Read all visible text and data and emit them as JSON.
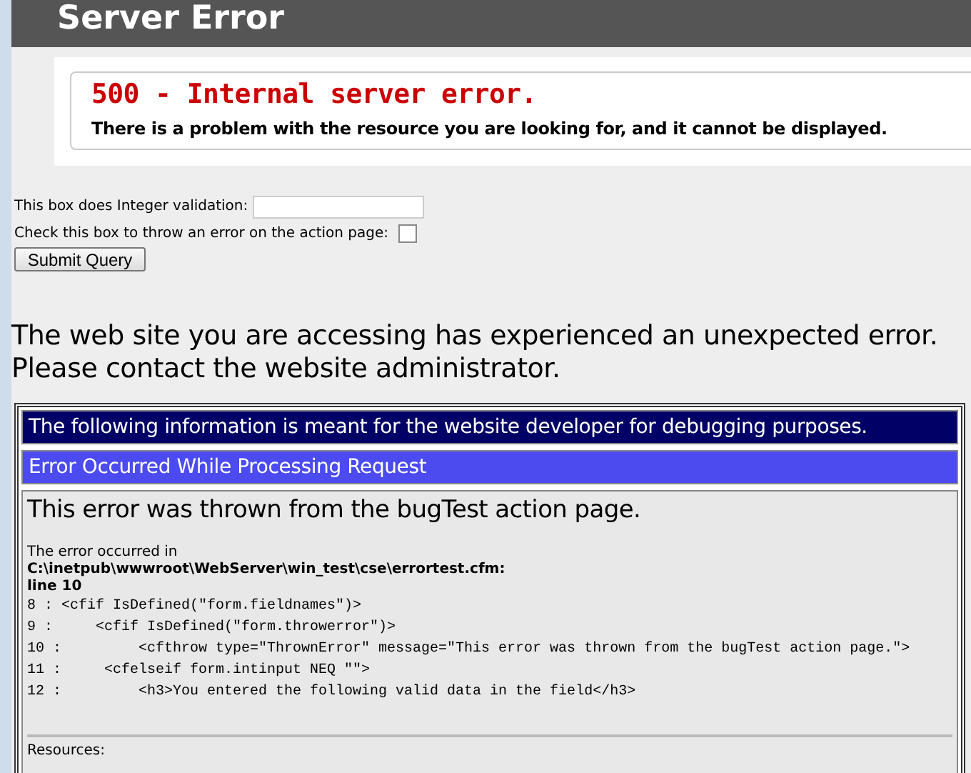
{
  "header": {
    "title": "Server Error"
  },
  "error_box": {
    "heading": "500 - Internal server error.",
    "message": "There is a problem with the resource you are looking for, and it cannot be displayed."
  },
  "form": {
    "input_label": "This box does Integer validation:",
    "checkbox_label": "Check this box to throw an error on the action page:",
    "checked": false,
    "submit": "Submit Query"
  },
  "notice": "The web site you are accessing has experienced an unexpected error.\nPlease contact the website administrator.",
  "debug": {
    "developer_banner": "The following information is meant for the website developer for debugging purposes.",
    "title_bar": "Error Occurred While Processing Request",
    "message": "This error was thrown from the bugTest action page.",
    "occurred_in": "The error occurred in",
    "file": "C:\\inetpub\\wwwroot\\WebServer\\win_test\\cse\\errortest.cfm:",
    "line": "line 10",
    "code_lines": [
      "8 : <cfif IsDefined(\"form.fieldnames\")>",
      "9 :     <cfif IsDefined(\"form.throwerror\")>",
      "10 :         <cfthrow type=\"ThrownError\" message=\"This error was thrown from the bugTest action page.\">",
      "11 :     <cfelseif form.intinput NEQ \"\">",
      "12 :         <h3>You entered the following valid data in the field</h3>"
    ],
    "resources": "Resources:"
  }
}
